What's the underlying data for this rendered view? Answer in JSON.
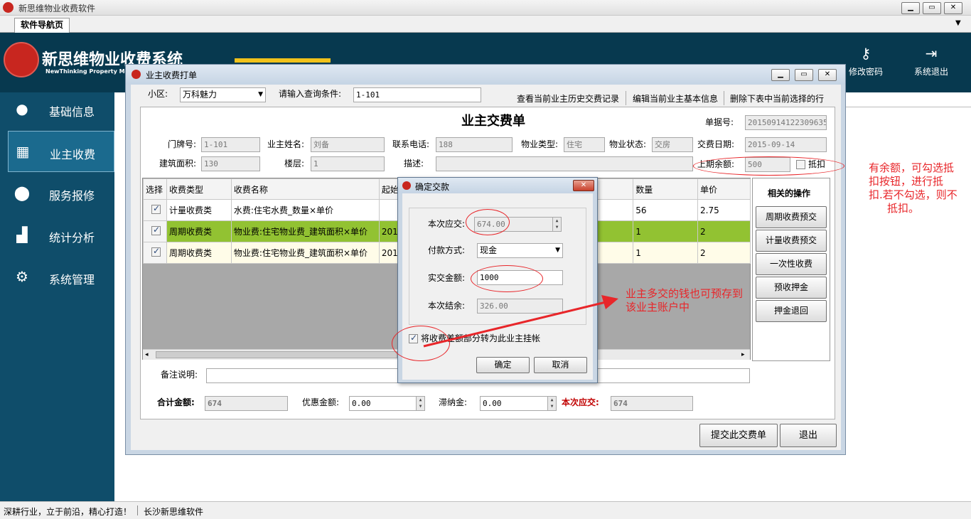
{
  "app": {
    "title": "新思维物业收费软件",
    "tab": "软件导航页",
    "win_min": "▁",
    "win_max": "▭",
    "win_close": "✕",
    "tab_arrow": "▼"
  },
  "brand": {
    "name": "新思维物业收费系统",
    "sub": "NewThinking Property Me"
  },
  "header_actions": [
    {
      "label": "修改密码",
      "icon": "key-icon"
    },
    {
      "label": "系统退出",
      "icon": "exit-icon"
    }
  ],
  "nav": [
    {
      "label": "基础信息",
      "icon": "user-icon"
    },
    {
      "label": "业主收费",
      "icon": "calendar-icon",
      "active": true
    },
    {
      "label": "服务报修",
      "icon": "location-pin-icon"
    },
    {
      "label": "统计分析",
      "icon": "bar-chart-icon"
    },
    {
      "label": "系统管理",
      "icon": "gear-icon"
    }
  ],
  "child": {
    "title": "业主收费打单",
    "community_label": "小区:",
    "community_value": "万科魅力",
    "query_label": "请输入查询条件:",
    "query_value": "1-101",
    "links": [
      "查看当前业主历史交费记录",
      "编辑当前业主基本信息",
      "删除下表中当前选择的行"
    ],
    "form_title": "业主交费单",
    "doc_no_label": "单据号:",
    "doc_no": "20150914122309635",
    "door_label": "门牌号:",
    "door": "1-101",
    "owner_label": "业主姓名:",
    "owner": "刘备",
    "phone_label": "联系电话:",
    "phone": "188",
    "ptype_label": "物业类型:",
    "ptype": "住宅",
    "pstatus_label": "物业状态:",
    "pstatus": "交房",
    "date_label": "交费日期:",
    "date": "2015-09-14",
    "area_label": "建筑面积:",
    "area": "130",
    "floor_label": "楼层:",
    "floor": "1",
    "desc_label": "描述:",
    "desc": "",
    "balance_label": "上期余额:",
    "balance": "500",
    "deduct_label": "抵扣",
    "table": {
      "headers": [
        "选择",
        "收费类型",
        "收费名称",
        "起始",
        "数量",
        "单价"
      ],
      "rows": [
        {
          "type": "计量收费类",
          "name": "水费:住宅水费_数量×单价",
          "start": "",
          "qty": "56",
          "price": "2.75"
        },
        {
          "type": "周期收费类",
          "name": "物业费:住宅物业费_建筑面积×单价",
          "start": "2015",
          "qty": "1",
          "price": "2"
        },
        {
          "type": "周期收费类",
          "name": "物业费:住宅物业费_建筑面积×单价",
          "start": "2015",
          "qty": "1",
          "price": "2"
        }
      ]
    },
    "ops_title": "相关的操作",
    "ops": [
      "周期收费预交",
      "计量收费预交",
      "一次性收费",
      "预收押金",
      "押金退回"
    ],
    "remark_label": "备注说明:",
    "remark": "",
    "total_label": "合计金额:",
    "total": "674",
    "discount_label": "优惠金额:",
    "discount": "0.00",
    "latefee_label": "滞纳金:",
    "latefee": "0.00",
    "due_label": "本次应交:",
    "due": "674",
    "submit": "提交此交费单",
    "exit": "退出"
  },
  "dialog": {
    "title": "确定交款",
    "due_label": "本次应交:",
    "due": "674.00",
    "pay_label": "付款方式:",
    "pay": "现金",
    "paid_label": "实交金额:",
    "paid": "1000",
    "change_label": "本次结余:",
    "change": "326.00",
    "transfer_label": "将收费差额部分转为此业主挂帐",
    "ok": "确定",
    "cancel": "取消"
  },
  "notes": {
    "right": [
      "有余额，可勾选抵",
      "扣按钮，进行抵",
      "扣.若不勾选，则不",
      "抵扣。"
    ],
    "middle": [
      "业主多交的钱也可预存到",
      "该业主账户中"
    ]
  },
  "status": {
    "left": "深耕行业，立于前沿，精心打造！",
    "right": "长沙新思维软件"
  },
  "colors": {
    "sidebar": "#0f4d6a",
    "header": "#07394f",
    "selected_row": "#92c232",
    "annotation": "#e8262a"
  }
}
